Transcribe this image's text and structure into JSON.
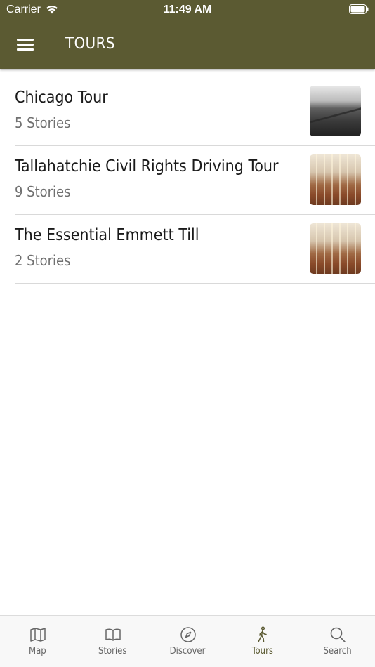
{
  "status_bar": {
    "carrier": "Carrier",
    "time": "11:49 AM"
  },
  "header": {
    "title": "TOURS",
    "background_color": "#5b5a32"
  },
  "tours": [
    {
      "title": "Chicago Tour",
      "subtitle": "5 Stories",
      "thumbnail": "chicago"
    },
    {
      "title": "Tallahatchie Civil Rights Driving Tour",
      "subtitle": "9 Stories",
      "thumbnail": "church"
    },
    {
      "title": "The Essential Emmett Till",
      "subtitle": "2 Stories",
      "thumbnail": "church"
    }
  ],
  "tab_bar": {
    "active": "Tours",
    "active_color": "#5b5a32",
    "tabs": [
      {
        "label": "Map",
        "icon": "map-icon"
      },
      {
        "label": "Stories",
        "icon": "book-icon"
      },
      {
        "label": "Discover",
        "icon": "compass-icon"
      },
      {
        "label": "Tours",
        "icon": "walking-person-icon"
      },
      {
        "label": "Search",
        "icon": "search-icon"
      }
    ]
  }
}
